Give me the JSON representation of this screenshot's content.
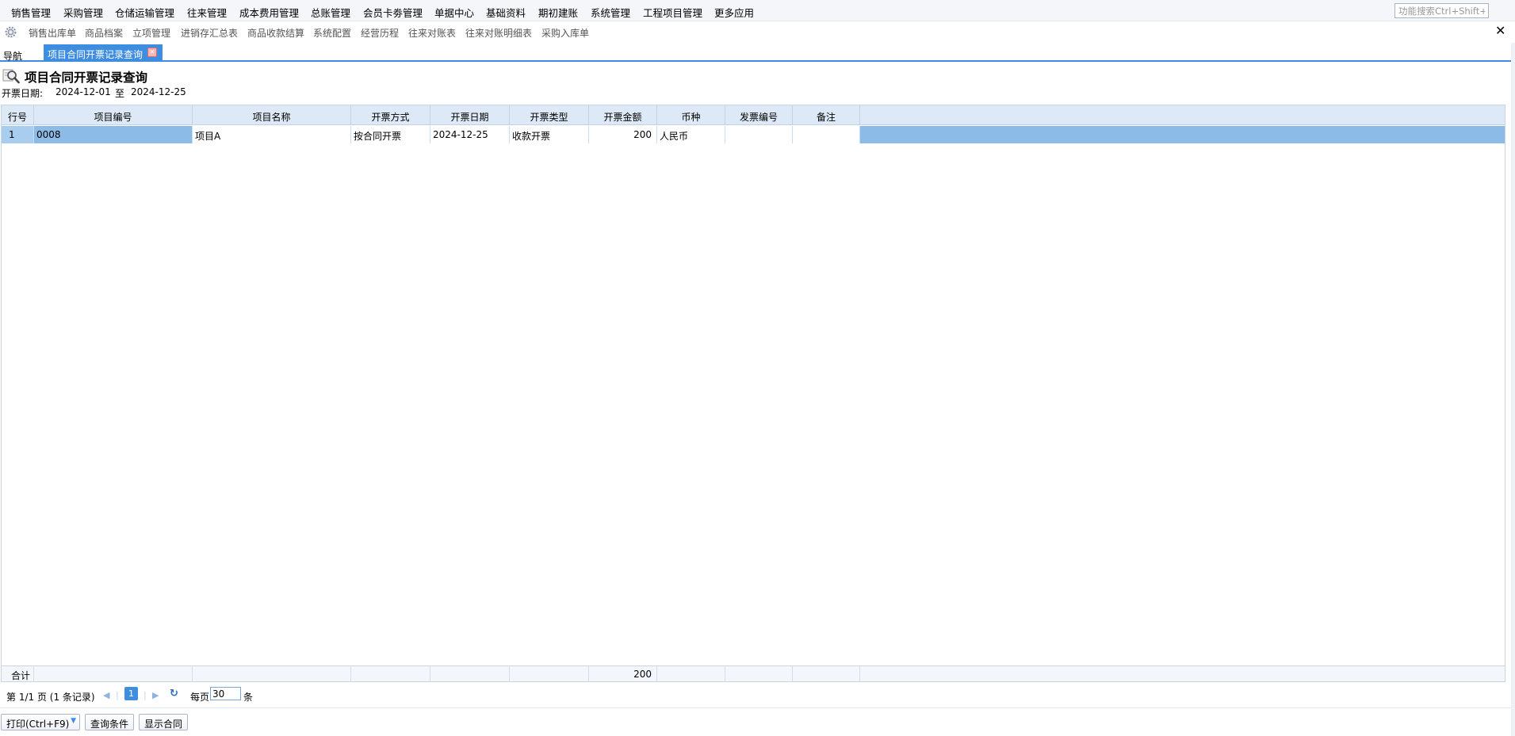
{
  "menu": {
    "items": [
      "销售管理",
      "采购管理",
      "仓储运输管理",
      "往来管理",
      "成本费用管理",
      "总账管理",
      "会员卡劵管理",
      "单据中心",
      "基础资料",
      "期初建账",
      "系统管理",
      "工程项目管理",
      "更多应用"
    ],
    "search_placeholder": "功能搜索Ctrl+Shift+F"
  },
  "shortcuts": {
    "items": [
      "销售出库单",
      "商品档案",
      "立项管理",
      "进销存汇总表",
      "商品收款结算",
      "系统配置",
      "经营历程",
      "往来对账表",
      "往来对账明细表",
      "采购入库单"
    ],
    "close_symbol": "✕"
  },
  "tabs": {
    "nav_label": "导航",
    "active_label": "项目合同开票记录查询",
    "close_symbol": "✕"
  },
  "page": {
    "title": "项目合同开票记录查询",
    "filter_label": "开票日期:",
    "date_from": "2024-12-01",
    "date_sep": "至",
    "date_to": "2024-12-25"
  },
  "grid": {
    "headers": [
      "行号",
      "项目编号",
      "项目名称",
      "开票方式",
      "开票日期",
      "开票类型",
      "开票金额",
      "币种",
      "发票编号",
      "备注"
    ],
    "rows": [
      {
        "rownum": "1",
        "project_code": "0008",
        "project_name": "项目A",
        "invoice_method": "按合同开票",
        "invoice_date": "2024-12-25",
        "invoice_type": "收款开票",
        "amount": "200",
        "currency": "人民币",
        "invoice_no": "",
        "remark": ""
      }
    ],
    "footer": {
      "label": "合计",
      "amount_total": "200"
    }
  },
  "pager": {
    "page_text": "第 1/1 页 (1 条记录)",
    "current_page": "1",
    "per_page_label": "每页",
    "per_page_value": "30",
    "unit": "条"
  },
  "buttons": {
    "print": "打印(Ctrl+F9)",
    "query": "查询条件",
    "show_contract": "显示合同"
  },
  "colors": {
    "accent": "#3f8de0",
    "selected_row": "#8dbbe7",
    "header_bg": "#dde9f6"
  }
}
